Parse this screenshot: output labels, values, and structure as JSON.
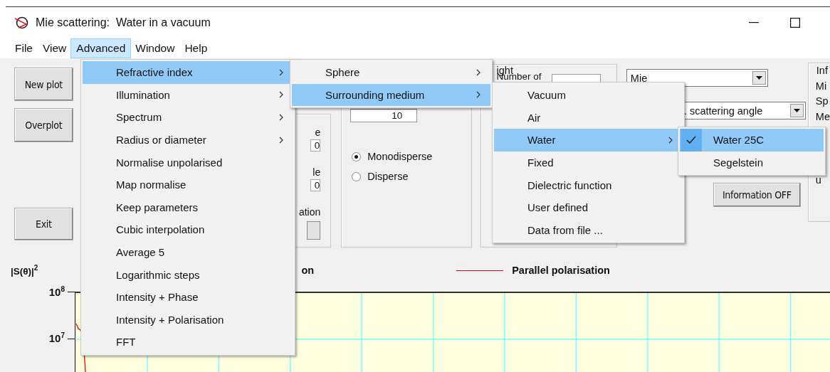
{
  "window": {
    "title": "Mie scattering:  Water in a vacuum"
  },
  "menu_bar": [
    {
      "label": "File",
      "selected": false
    },
    {
      "label": "View",
      "selected": false
    },
    {
      "label": "Advanced",
      "selected": true
    },
    {
      "label": "Window",
      "selected": false
    },
    {
      "label": "Help",
      "selected": false
    }
  ],
  "open_menus": [
    {
      "items": [
        {
          "label": "Refractive index",
          "submenu": true,
          "selected": true
        },
        {
          "label": "Illumination",
          "submenu": true,
          "selected": false
        },
        {
          "label": "Spectrum",
          "submenu": true,
          "selected": false
        },
        {
          "label": "Radius or diameter",
          "submenu": true,
          "selected": false
        },
        {
          "label": "Normalise unpolarised",
          "submenu": false,
          "selected": false
        },
        {
          "label": "Map normalise",
          "submenu": false,
          "selected": false
        },
        {
          "label": "Keep parameters",
          "submenu": false,
          "selected": false
        },
        {
          "label": "Cubic interpolation",
          "submenu": false,
          "selected": false
        },
        {
          "label": "Average  5",
          "submenu": false,
          "selected": false
        },
        {
          "label": "Logarithmic steps",
          "submenu": false,
          "selected": false
        },
        {
          "label": "Intensity + Phase",
          "submenu": false,
          "selected": false
        },
        {
          "label": "Intensity + Polarisation",
          "submenu": false,
          "selected": false
        },
        {
          "label": "FFT",
          "submenu": false,
          "selected": false
        }
      ]
    },
    {
      "items": [
        {
          "label": "Sphere",
          "submenu": true,
          "selected": false
        },
        {
          "label": "Surrounding medium",
          "submenu": true,
          "selected": true
        }
      ]
    },
    {
      "items": [
        {
          "label": "Vacuum",
          "submenu": false,
          "selected": false
        },
        {
          "label": "Air",
          "submenu": false,
          "selected": false
        },
        {
          "label": "Water",
          "submenu": true,
          "selected": true
        },
        {
          "label": "Fixed",
          "submenu": false,
          "selected": false
        },
        {
          "label": "Dielectric function",
          "submenu": false,
          "selected": false
        },
        {
          "label": "User defined",
          "submenu": false,
          "selected": false
        },
        {
          "label": "Data from file ...",
          "submenu": false,
          "selected": false
        }
      ]
    },
    {
      "items": [
        {
          "label": "Water 25C",
          "submenu": false,
          "selected": true,
          "checked": true
        },
        {
          "label": "Segelstein",
          "submenu": false,
          "selected": false,
          "checked": false
        }
      ]
    }
  ],
  "buttons": [
    "New plot",
    "Overplot",
    "Exit"
  ],
  "panel_1": {
    "items": [
      {
        "kind": "label",
        "text": "e"
      },
      {
        "kind": "field",
        "value": "0"
      },
      {
        "kind": "label",
        "text": "le"
      },
      {
        "kind": "field",
        "value": "0"
      },
      {
        "kind": "label",
        "text": "ation"
      },
      {
        "kind": "button"
      }
    ]
  },
  "panel_2": {
    "field": "10",
    "radios": [
      {
        "label": "Monodisperse",
        "selected": true
      },
      {
        "label": "Disperse",
        "selected": false
      }
    ]
  },
  "panel_3": {
    "group_label": "ight",
    "label": "Number of"
  },
  "dropdowns": [
    {
      "value": "Mie"
    },
    {
      "value": ". scattering angle"
    }
  ],
  "info_button": "Information OFF",
  "info_group": {
    "label": "Inf",
    "lines": [
      "Mi",
      "Sp",
      "Me"
    ],
    "note": "u"
  },
  "plot": {
    "y_label": "|S(θ)|$^{2}$",
    "y_ticks": [
      "10$^{8}$",
      "10$^{7}$"
    ],
    "legend": [
      "on",
      "Parallel polarisation"
    ]
  }
}
